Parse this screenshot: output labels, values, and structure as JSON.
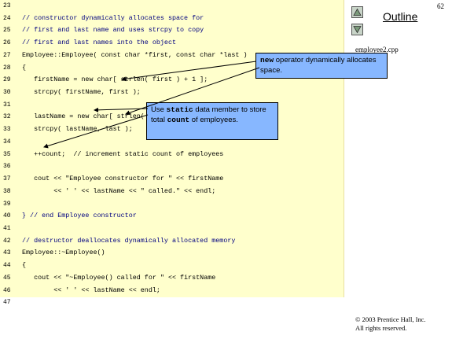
{
  "slide": {
    "page_number": "62",
    "outline_label": "Outline",
    "filename": "employee2.cpp",
    "copyright_line1": "© 2003 Prentice Hall, Inc.",
    "copyright_line2": "All rights reserved."
  },
  "nav": {
    "up_icon": "triangle-up-icon",
    "down_icon": "triangle-down-icon"
  },
  "code_lines": [
    {
      "num": "23",
      "text": ""
    },
    {
      "num": "24",
      "text": "// constructor dynamically allocates space for"
    },
    {
      "num": "25",
      "text": "// first and last name and uses strcpy to copy"
    },
    {
      "num": "26",
      "text": "// first and last names into the object"
    },
    {
      "num": "27",
      "text": "Employee::Employee( const char *first, const char *last )"
    },
    {
      "num": "28",
      "text": "{"
    },
    {
      "num": "29",
      "text": "   firstName = new char[ strlen( first ) + 1 ];"
    },
    {
      "num": "30",
      "text": "   strcpy( firstName, first );"
    },
    {
      "num": "31",
      "text": ""
    },
    {
      "num": "32",
      "text": "   lastName = new char[ strlen( last ) + 1 ];"
    },
    {
      "num": "33",
      "text": "   strcpy( lastName, last );"
    },
    {
      "num": "34",
      "text": ""
    },
    {
      "num": "35",
      "text": "   ++count;  // increment static count of employees"
    },
    {
      "num": "36",
      "text": ""
    },
    {
      "num": "37",
      "text": "   cout << \"Employee constructor for \" << firstName"
    },
    {
      "num": "38",
      "text": "        << ' ' << lastName << \" called.\" << endl;"
    },
    {
      "num": "39",
      "text": ""
    },
    {
      "num": "40",
      "text": "} // end Employee constructor"
    },
    {
      "num": "41",
      "text": ""
    },
    {
      "num": "42",
      "text": "// destructor deallocates dynamically allocated memory"
    },
    {
      "num": "43",
      "text": "Employee::~Employee()"
    },
    {
      "num": "44",
      "text": "{"
    },
    {
      "num": "45",
      "text": "   cout << \"~Employee() called for \" << firstName"
    },
    {
      "num": "46",
      "text": "        << ' ' << lastName << endl;"
    },
    {
      "num": "47",
      "text": ""
    }
  ],
  "callouts": {
    "new_operator": {
      "keyword": "new",
      "text": " operator dynamically allocates space."
    },
    "static_member": {
      "pre": "Use ",
      "keyword1": "static",
      "mid": " data member to store total ",
      "keyword2": "count",
      "post": " of employees."
    }
  },
  "colors": {
    "code_background": "#ffffcc",
    "callout_background": "#87b7ff",
    "nav_button": "#c8d4c8"
  }
}
